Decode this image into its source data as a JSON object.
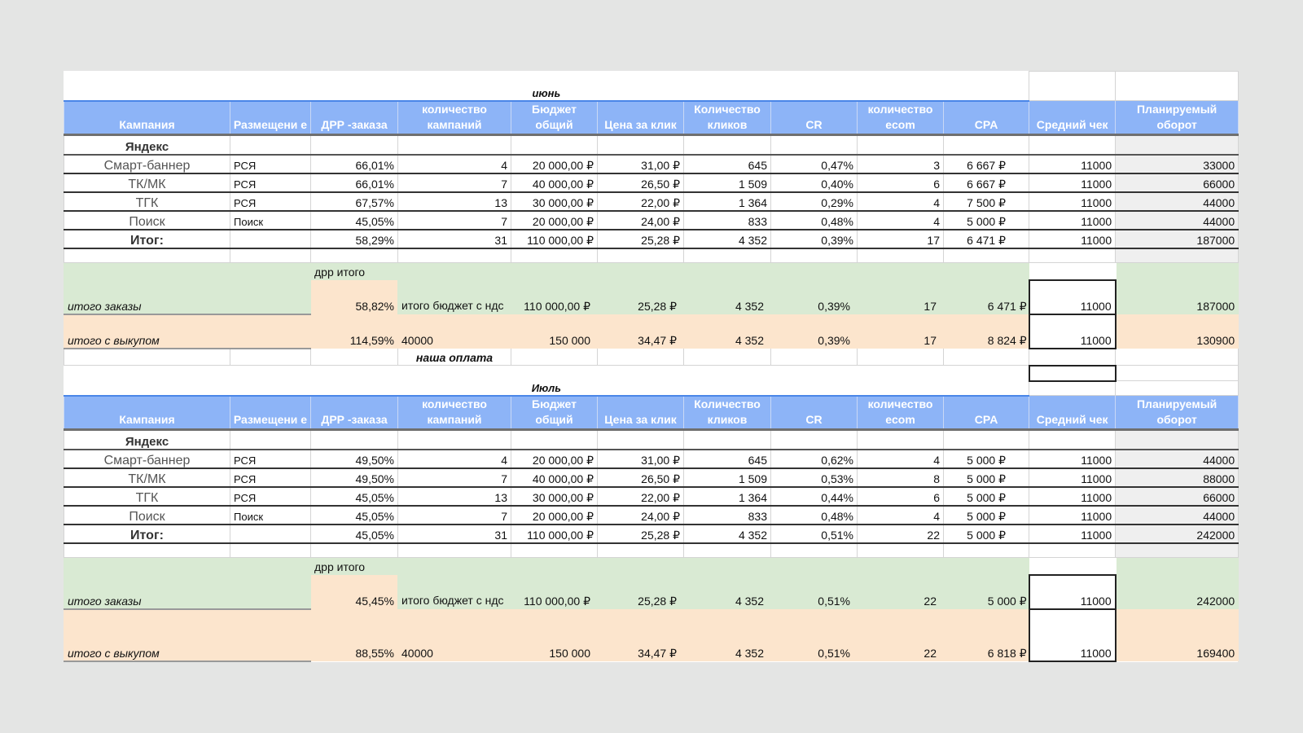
{
  "headers": [
    "Кампания",
    "Размещени е",
    "ДРР -заказа",
    "количество кампаний",
    "Бюджет общий",
    "Цена за клик",
    "Количество кликов",
    "CR",
    "количество ecom",
    "CPA",
    "Средний чек",
    "Планируемый оборот"
  ],
  "sections": [
    {
      "month": "июнь",
      "group": "Яндекс",
      "rows": [
        [
          "Смарт-баннер",
          "РСЯ",
          "66,01%",
          "4",
          "20 000,00 ₽",
          "31,00 ₽",
          "645",
          "0,47%",
          "3",
          "6 667 ₽",
          "11000",
          "33000"
        ],
        [
          "ТК/МК",
          "РСЯ",
          "66,01%",
          "7",
          "40 000,00 ₽",
          "26,50 ₽",
          "1 509",
          "0,40%",
          "6",
          "6 667 ₽",
          "11000",
          "66000"
        ],
        [
          "ТГК",
          "РСЯ",
          "67,57%",
          "13",
          "30 000,00 ₽",
          "22,00 ₽",
          "1 364",
          "0,29%",
          "4",
          "7 500 ₽",
          "11000",
          "44000"
        ],
        [
          "Поиск",
          "Поиск",
          "45,05%",
          "7",
          "20 000,00 ₽",
          "24,00 ₽",
          "833",
          "0,48%",
          "4",
          "5 000 ₽",
          "11000",
          "44000"
        ]
      ],
      "total": [
        "Итог:",
        "",
        "58,29%",
        "31",
        "110 000,00 ₽",
        "25,28 ₽",
        "4 352",
        "0,39%",
        "17",
        "6 471 ₽",
        "11000",
        "187000"
      ],
      "orders": {
        "label": "итого заказы",
        "drr_label": "дрр итого",
        "drr": "58,82%",
        "budget_label": "итого бюджет с ндс",
        "values": [
          "110 000,00 ₽",
          "25,28 ₽",
          "4 352",
          "0,39%",
          "17",
          "6 471 ₽"
        ],
        "avg_check": "11000",
        "turnover": "187000"
      },
      "buyout": {
        "label": "итого с выкупом",
        "drr": "114,59%",
        "budget": "40000",
        "values": [
          "150 000",
          "34,47 ₽",
          "4 352",
          "0,39%",
          "17",
          "8 824 ₽"
        ],
        "avg_check": "11000",
        "turnover": "130900"
      },
      "note": "наша оплата"
    },
    {
      "month": "Июль",
      "group": "Яндекс",
      "rows": [
        [
          "Смарт-баннер",
          "РСЯ",
          "49,50%",
          "4",
          "20 000,00 ₽",
          "31,00 ₽",
          "645",
          "0,62%",
          "4",
          "5 000 ₽",
          "11000",
          "44000"
        ],
        [
          "ТК/МК",
          "РСЯ",
          "49,50%",
          "7",
          "40 000,00 ₽",
          "26,50 ₽",
          "1 509",
          "0,53%",
          "8",
          "5 000 ₽",
          "11000",
          "88000"
        ],
        [
          "ТГК",
          "РСЯ",
          "45,05%",
          "13",
          "30 000,00 ₽",
          "22,00 ₽",
          "1 364",
          "0,44%",
          "6",
          "5 000 ₽",
          "11000",
          "66000"
        ],
        [
          "Поиск",
          "Поиск",
          "45,05%",
          "7",
          "20 000,00 ₽",
          "24,00 ₽",
          "833",
          "0,48%",
          "4",
          "5 000 ₽",
          "11000",
          "44000"
        ]
      ],
      "total": [
        "Итог:",
        "",
        "45,05%",
        "31",
        "110 000,00 ₽",
        "25,28 ₽",
        "4 352",
        "0,51%",
        "22",
        "5 000 ₽",
        "11000",
        "242000"
      ],
      "orders": {
        "label": "итого заказы",
        "drr_label": "дрр итого",
        "drr": "45,45%",
        "budget_label": "итого бюджет с ндс",
        "values": [
          "110 000,00 ₽",
          "25,28 ₽",
          "4 352",
          "0,51%",
          "22",
          "5 000 ₽"
        ],
        "avg_check": "11000",
        "turnover": "242000"
      },
      "buyout": {
        "label": "итого с выкупом",
        "drr": "88,55%",
        "budget": "40000",
        "values": [
          "150 000",
          "34,47 ₽",
          "4 352",
          "0,51%",
          "22",
          "6 818 ₽"
        ],
        "avg_check": "11000",
        "turnover": "169400"
      }
    }
  ]
}
